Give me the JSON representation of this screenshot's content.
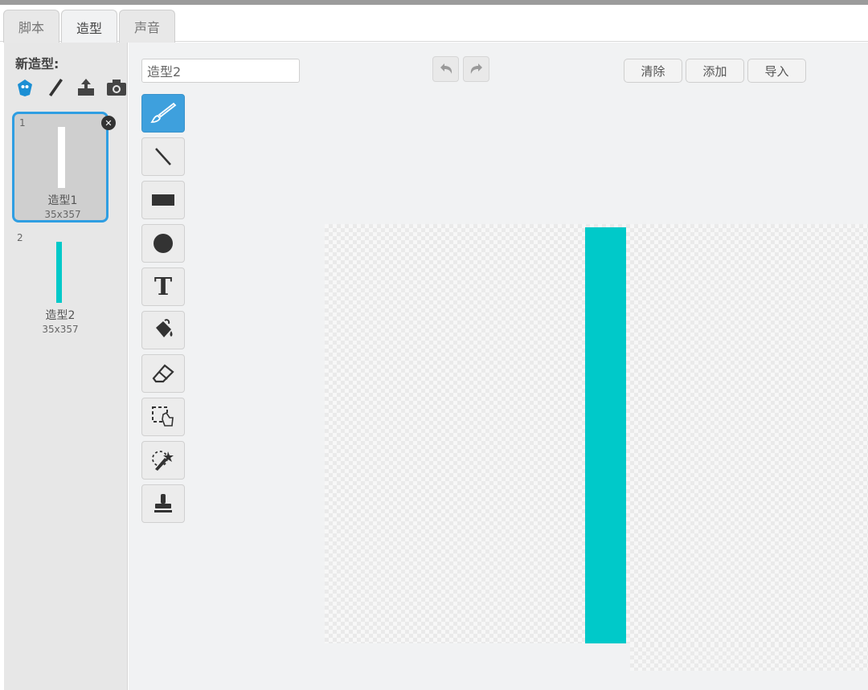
{
  "tabs": [
    {
      "label": "脚本",
      "active": false
    },
    {
      "label": "造型",
      "active": true
    },
    {
      "label": "声音",
      "active": false
    }
  ],
  "left_panel": {
    "new_costume_label": "新造型:",
    "new_icons": [
      "choose-from-library-icon",
      "paint-new-icon",
      "upload-icon",
      "camera-icon"
    ],
    "costumes": [
      {
        "number": "1",
        "name": "造型1",
        "size": "35x357",
        "color": "#ffffff",
        "selected": true
      },
      {
        "number": "2",
        "name": "造型2",
        "size": "35x357",
        "color": "#00c9c9",
        "selected": false
      }
    ]
  },
  "editor": {
    "costume_name": "造型2",
    "buttons": {
      "clear": "清除",
      "add": "添加",
      "import": "导入"
    },
    "tools": [
      "brush-icon",
      "line-icon",
      "rectangle-icon",
      "ellipse-icon",
      "text-icon",
      "fill-icon",
      "eraser-icon",
      "select-icon",
      "reshape-icon",
      "stamp-icon"
    ],
    "active_tool": "brush-icon",
    "text_tool_glyph": "T",
    "sprite_color": "#00c9c9",
    "accent": "#3ea0dd"
  }
}
